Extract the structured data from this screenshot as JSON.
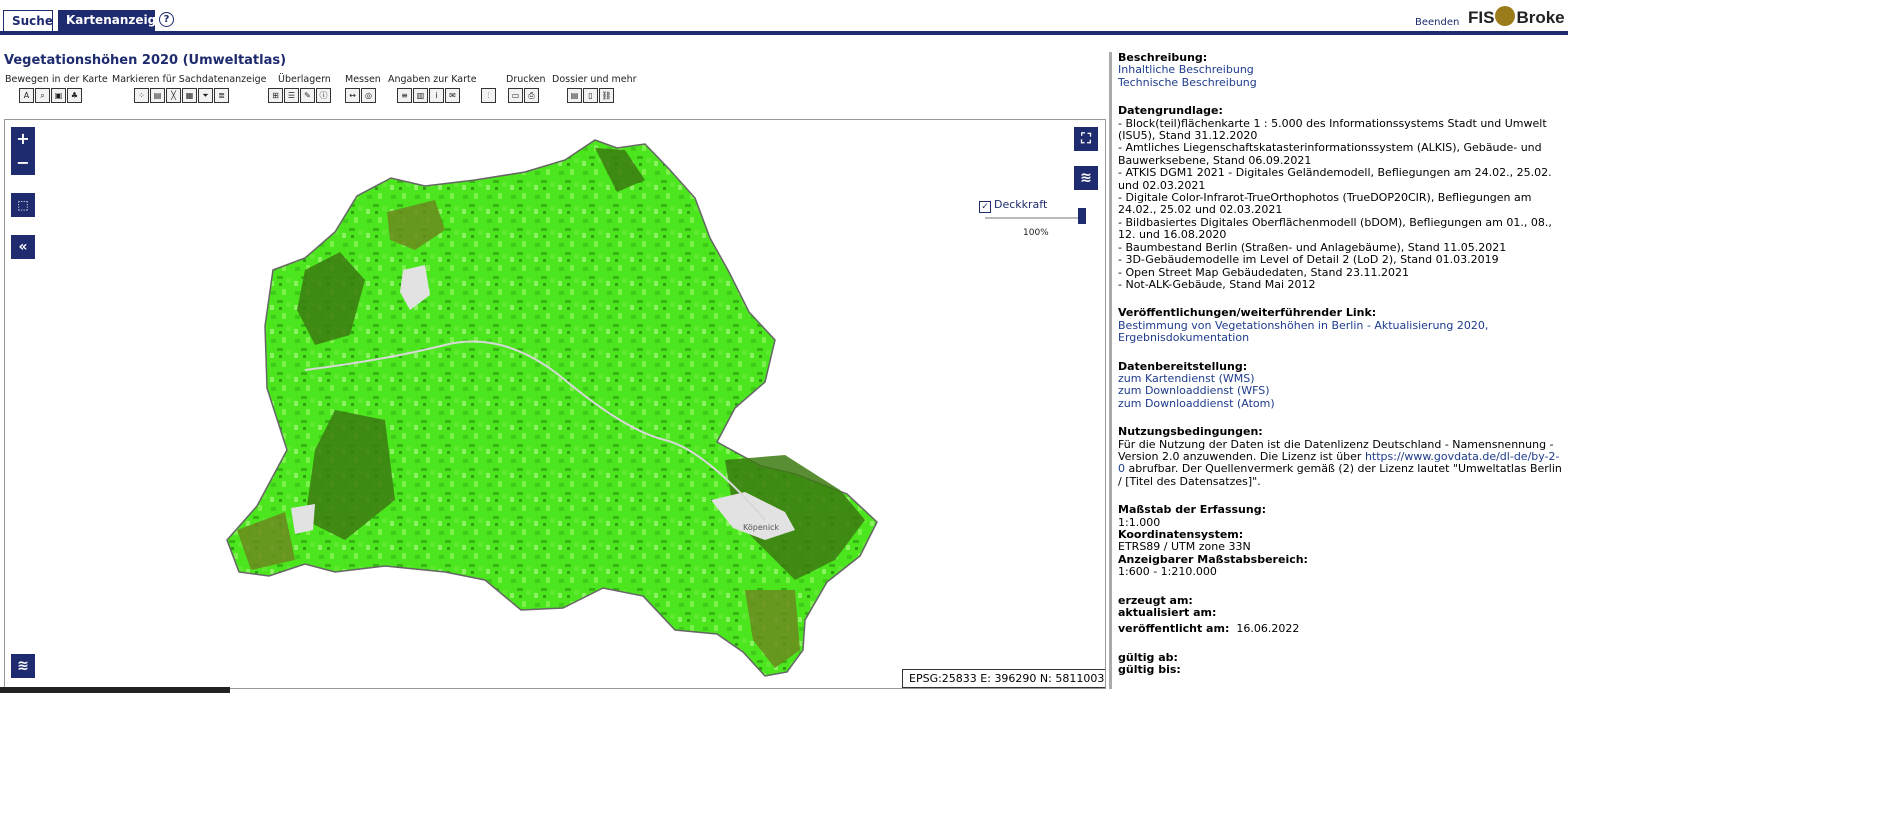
{
  "tabs": {
    "search": "Suche",
    "map": "Kartenanzeige",
    "help": "?"
  },
  "header": {
    "logout": "Beenden",
    "logo_left": "FIS",
    "logo_right": "Broke"
  },
  "map": {
    "title": "Vegetationshöhen 2020 (Umweltatlas)",
    "toolbar": [
      {
        "label": "Bewegen in der Karte"
      },
      {
        "label": "Markieren für Sachdatenanzeige"
      },
      {
        "label": "Überlagern"
      },
      {
        "label": "Messen"
      },
      {
        "label": "Angaben zur Karte"
      },
      {
        "label": "Drucken"
      },
      {
        "label": "Dossier und mehr"
      }
    ],
    "controls": {
      "zoom_in": "+",
      "zoom_out": "−",
      "collapse": "«"
    },
    "opacity": {
      "label": "Deckkraft",
      "value": "100%",
      "checked": true,
      "level": 1.0
    },
    "place_label": "Köpenick",
    "coords": "EPSG:25833 E: 396290 N: 5811003"
  },
  "sidebar": {
    "description_heading": "Beschreibung:",
    "links": [
      "Inhaltliche Beschreibung",
      "Technische Beschreibung"
    ],
    "basis_heading": "Datengrundlage:",
    "basis": [
      "- Block(teil)flächenkarte 1 : 5.000 des Informationssystems Stadt und Umwelt (ISU5), Stand 31.12.2020",
      "- Amtliches Liegenschaftskatasterinformationssystem (ALKIS), Gebäude- und Bauwerksebene, Stand 06.09.2021",
      "- ATKIS DGM1 2021 - Digitales Geländemodell, Befliegungen am 24.02., 25.02. und 02.03.2021",
      "- Digitale Color-Infrarot-TrueOrthophotos (TrueDOP20CIR), Befliegungen am 24.02., 25.02 und 02.03.2021",
      "- Bildbasiertes Digitales Oberflächenmodell (bDOM), Befliegungen am 01., 08., 12. und 16.08.2020",
      "- Baumbestand Berlin (Straßen- und Anlagebäume), Stand 11.05.2021",
      "- 3D-Gebäudemodelle im Level of Detail 2 (LoD 2), Stand 01.03.2019",
      "- Open Street Map Gebäudedaten, Stand 23.11.2021",
      "- Not-ALK-Gebäude, Stand Mai 2012"
    ],
    "pub_heading": "Veröffentlichungen/weiterführender Link:",
    "pub_link": "Bestimmung von Vegetationshöhen in Berlin - Aktualisierung 2020, Ergebnisdokumentation",
    "provision_heading": "Datenbereitstellung:",
    "provision_links": [
      "zum Kartendienst (WMS)",
      "zum Downloaddienst (WFS)",
      "zum Downloaddienst (Atom)"
    ],
    "terms_heading": "Nutzungsbedingungen:",
    "terms_a": "Für die Nutzung der Daten ist die Datenlizenz Deutschland - Namensnennung - Version 2.0 anzuwenden. Die Lizenz ist über ",
    "terms_link": "https://www.govdata.de/dl-de/by-2-0",
    "terms_b": " abrufbar. Der Quellenvermerk gemäß (2) der Lizenz lautet \"Umweltatlas Berlin / [Titel des Datensatzes]\".",
    "scale_label": "Maßstab der Erfassung:",
    "scale_value": "1:1.000",
    "crs_label": "Koordinatensystem:",
    "crs_value": "ETRS89 / UTM zone 33N",
    "range_label": "Anzeigbarer Maßstabsbereich:",
    "range_value": "1:600 - 1:210.000",
    "created_label": "erzeugt am:",
    "updated_label": "aktualisiert am:",
    "published_label": "veröffentlicht am:",
    "published_value": "16.06.2022",
    "valid_from_label": "gültig ab:",
    "valid_to_label": "gültig bis:"
  },
  "colors": {
    "brand": "#1e2b6e",
    "veg_light": "#4ce61f",
    "veg_dark": "#3c7a12",
    "veg_olive": "#6b8a1e",
    "link": "#1e3c8c"
  }
}
